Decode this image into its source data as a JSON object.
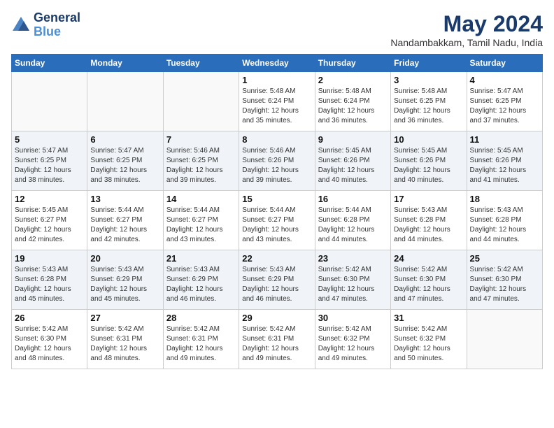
{
  "header": {
    "logo_line1": "General",
    "logo_line2": "Blue",
    "month_title": "May 2024",
    "location": "Nandambakkam, Tamil Nadu, India"
  },
  "days_of_week": [
    "Sunday",
    "Monday",
    "Tuesday",
    "Wednesday",
    "Thursday",
    "Friday",
    "Saturday"
  ],
  "weeks": [
    [
      {
        "day": "",
        "info": ""
      },
      {
        "day": "",
        "info": ""
      },
      {
        "day": "",
        "info": ""
      },
      {
        "day": "1",
        "info": "Sunrise: 5:48 AM\nSunset: 6:24 PM\nDaylight: 12 hours\nand 35 minutes."
      },
      {
        "day": "2",
        "info": "Sunrise: 5:48 AM\nSunset: 6:24 PM\nDaylight: 12 hours\nand 36 minutes."
      },
      {
        "day": "3",
        "info": "Sunrise: 5:48 AM\nSunset: 6:25 PM\nDaylight: 12 hours\nand 36 minutes."
      },
      {
        "day": "4",
        "info": "Sunrise: 5:47 AM\nSunset: 6:25 PM\nDaylight: 12 hours\nand 37 minutes."
      }
    ],
    [
      {
        "day": "5",
        "info": "Sunrise: 5:47 AM\nSunset: 6:25 PM\nDaylight: 12 hours\nand 38 minutes."
      },
      {
        "day": "6",
        "info": "Sunrise: 5:47 AM\nSunset: 6:25 PM\nDaylight: 12 hours\nand 38 minutes."
      },
      {
        "day": "7",
        "info": "Sunrise: 5:46 AM\nSunset: 6:25 PM\nDaylight: 12 hours\nand 39 minutes."
      },
      {
        "day": "8",
        "info": "Sunrise: 5:46 AM\nSunset: 6:26 PM\nDaylight: 12 hours\nand 39 minutes."
      },
      {
        "day": "9",
        "info": "Sunrise: 5:45 AM\nSunset: 6:26 PM\nDaylight: 12 hours\nand 40 minutes."
      },
      {
        "day": "10",
        "info": "Sunrise: 5:45 AM\nSunset: 6:26 PM\nDaylight: 12 hours\nand 40 minutes."
      },
      {
        "day": "11",
        "info": "Sunrise: 5:45 AM\nSunset: 6:26 PM\nDaylight: 12 hours\nand 41 minutes."
      }
    ],
    [
      {
        "day": "12",
        "info": "Sunrise: 5:45 AM\nSunset: 6:27 PM\nDaylight: 12 hours\nand 42 minutes."
      },
      {
        "day": "13",
        "info": "Sunrise: 5:44 AM\nSunset: 6:27 PM\nDaylight: 12 hours\nand 42 minutes."
      },
      {
        "day": "14",
        "info": "Sunrise: 5:44 AM\nSunset: 6:27 PM\nDaylight: 12 hours\nand 43 minutes."
      },
      {
        "day": "15",
        "info": "Sunrise: 5:44 AM\nSunset: 6:27 PM\nDaylight: 12 hours\nand 43 minutes."
      },
      {
        "day": "16",
        "info": "Sunrise: 5:44 AM\nSunset: 6:28 PM\nDaylight: 12 hours\nand 44 minutes."
      },
      {
        "day": "17",
        "info": "Sunrise: 5:43 AM\nSunset: 6:28 PM\nDaylight: 12 hours\nand 44 minutes."
      },
      {
        "day": "18",
        "info": "Sunrise: 5:43 AM\nSunset: 6:28 PM\nDaylight: 12 hours\nand 44 minutes."
      }
    ],
    [
      {
        "day": "19",
        "info": "Sunrise: 5:43 AM\nSunset: 6:28 PM\nDaylight: 12 hours\nand 45 minutes."
      },
      {
        "day": "20",
        "info": "Sunrise: 5:43 AM\nSunset: 6:29 PM\nDaylight: 12 hours\nand 45 minutes."
      },
      {
        "day": "21",
        "info": "Sunrise: 5:43 AM\nSunset: 6:29 PM\nDaylight: 12 hours\nand 46 minutes."
      },
      {
        "day": "22",
        "info": "Sunrise: 5:43 AM\nSunset: 6:29 PM\nDaylight: 12 hours\nand 46 minutes."
      },
      {
        "day": "23",
        "info": "Sunrise: 5:42 AM\nSunset: 6:30 PM\nDaylight: 12 hours\nand 47 minutes."
      },
      {
        "day": "24",
        "info": "Sunrise: 5:42 AM\nSunset: 6:30 PM\nDaylight: 12 hours\nand 47 minutes."
      },
      {
        "day": "25",
        "info": "Sunrise: 5:42 AM\nSunset: 6:30 PM\nDaylight: 12 hours\nand 47 minutes."
      }
    ],
    [
      {
        "day": "26",
        "info": "Sunrise: 5:42 AM\nSunset: 6:30 PM\nDaylight: 12 hours\nand 48 minutes."
      },
      {
        "day": "27",
        "info": "Sunrise: 5:42 AM\nSunset: 6:31 PM\nDaylight: 12 hours\nand 48 minutes."
      },
      {
        "day": "28",
        "info": "Sunrise: 5:42 AM\nSunset: 6:31 PM\nDaylight: 12 hours\nand 49 minutes."
      },
      {
        "day": "29",
        "info": "Sunrise: 5:42 AM\nSunset: 6:31 PM\nDaylight: 12 hours\nand 49 minutes."
      },
      {
        "day": "30",
        "info": "Sunrise: 5:42 AM\nSunset: 6:32 PM\nDaylight: 12 hours\nand 49 minutes."
      },
      {
        "day": "31",
        "info": "Sunrise: 5:42 AM\nSunset: 6:32 PM\nDaylight: 12 hours\nand 50 minutes."
      },
      {
        "day": "",
        "info": ""
      }
    ]
  ]
}
